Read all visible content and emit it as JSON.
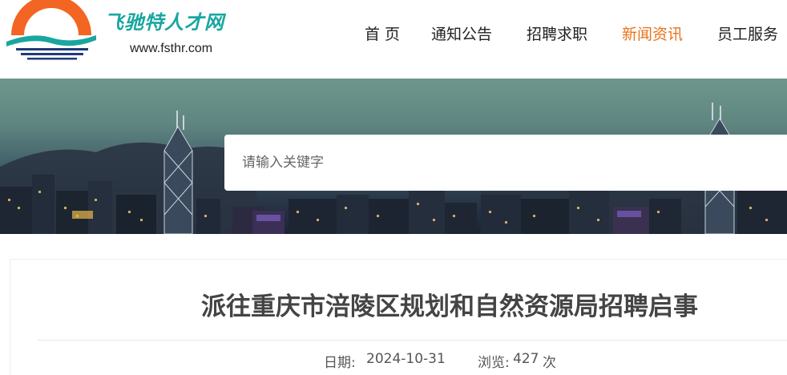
{
  "brand": {
    "name": "飞驰特人才网",
    "url": "www.fsthr.com",
    "colors": {
      "orange": "#f26522",
      "teal": "#1aa6a0",
      "navy": "#1f3b78"
    }
  },
  "nav": {
    "items": [
      {
        "label": "首 页"
      },
      {
        "label": "通知公告"
      },
      {
        "label": "招聘求职"
      },
      {
        "label": "新闻资讯",
        "active": true
      },
      {
        "label": "员工服务"
      }
    ],
    "active_color": "#e8731c"
  },
  "search": {
    "placeholder": "请输入关键字",
    "value": ""
  },
  "article": {
    "title": "派往重庆市涪陵区规划和自然资源局招聘启事",
    "date_label": "日期:",
    "date": "2024-10-31",
    "views_label": "浏览:",
    "views": "427",
    "views_unit": "次"
  }
}
